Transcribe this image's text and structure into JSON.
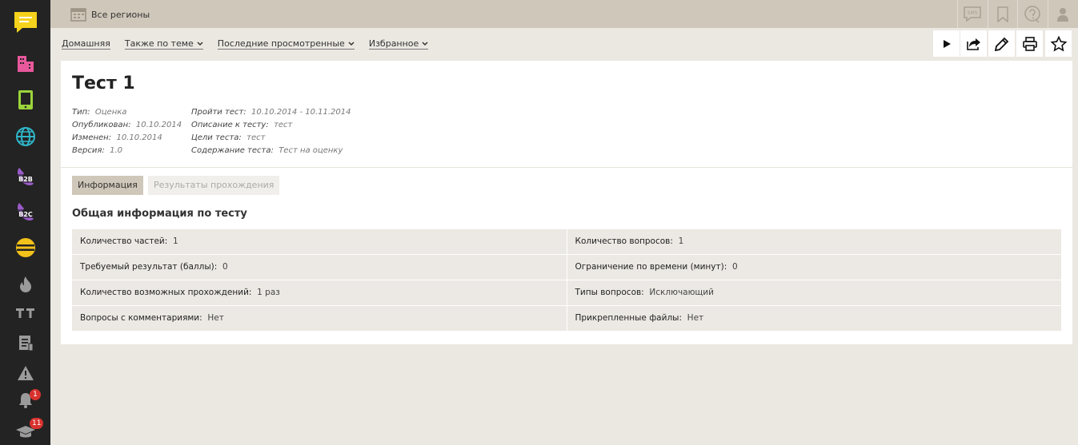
{
  "sidebar": {
    "items": [
      {
        "icon": "chat-icon",
        "color": "#f5d21c"
      },
      {
        "icon": "building-icon",
        "color": "#e8589c"
      },
      {
        "icon": "tablet-icon",
        "color": "#9bd43b"
      },
      {
        "icon": "globe-icon",
        "color": "#2fb5c7"
      },
      {
        "icon": "b2b-phone-icon",
        "label": "B2B",
        "color": "#9a5bc9"
      },
      {
        "icon": "b2c-phone-icon",
        "label": "B2C",
        "color": "#9a5bc9"
      },
      {
        "icon": "equals-circle-icon",
        "color": "#f2c11a"
      },
      {
        "icon": "flame-icon",
        "color": "#9b9b9b"
      },
      {
        "icon": "tt-icon",
        "label": "TT",
        "color": "#9b9b9b"
      },
      {
        "icon": "document-icon",
        "color": "#9b9b9b"
      },
      {
        "icon": "warning-icon",
        "color": "#9b9b9b"
      },
      {
        "icon": "bell-icon",
        "badge": "1",
        "color": "#9b9b9b"
      },
      {
        "icon": "graduation-cap-icon",
        "badge": "11",
        "color": "#9b9b9b"
      }
    ]
  },
  "topbar": {
    "region": "Все регионы",
    "icons": [
      "sms-icon",
      "bookmark-icon",
      "help-icon",
      "user-icon"
    ],
    "sms_label": "SMS"
  },
  "nav": {
    "home": "Домашняя",
    "related": "Также по теме",
    "recent": "Последние просмотренные",
    "favorites": "Избранное"
  },
  "actions": [
    "play-icon",
    "share-icon",
    "edit-icon",
    "print-icon",
    "star-icon"
  ],
  "page": {
    "title": "Тест 1",
    "meta_left": [
      {
        "label": "Тип:",
        "value": "Оценка"
      },
      {
        "label": "Опубликован:",
        "value": "10.10.2014"
      },
      {
        "label": "Изменен:",
        "value": "10.10.2014"
      },
      {
        "label": "Версия:",
        "value": "1.0"
      }
    ],
    "meta_right": [
      {
        "label": "Пройти тест:",
        "value": "10.10.2014 - 10.11.2014"
      },
      {
        "label": "Описание к тесту:",
        "value": "тест"
      },
      {
        "label": "Цели теста:",
        "value": "тест"
      },
      {
        "label": "Содержание теста:",
        "value": "Тест на оценку"
      }
    ]
  },
  "tabs": {
    "info": "Информация",
    "results": "Результаты прохождения"
  },
  "section_title": "Общая информация по тесту",
  "info_rows": [
    [
      {
        "label": "Количество частей:",
        "value": "1"
      },
      {
        "label": "Количество вопросов:",
        "value": "1"
      }
    ],
    [
      {
        "label": "Требуемый результат (баллы):",
        "value": "0"
      },
      {
        "label": "Ограничение по времени (минут):",
        "value": "0"
      }
    ],
    [
      {
        "label": "Количество возможных прохождений:",
        "value": "1 раз"
      },
      {
        "label": "Типы вопросов:",
        "value": "Исключающий"
      }
    ],
    [
      {
        "label": "Вопросы с комментариями:",
        "value": "Нет"
      },
      {
        "label": "Прикрепленные файлы:",
        "value": "Нет"
      }
    ]
  ]
}
